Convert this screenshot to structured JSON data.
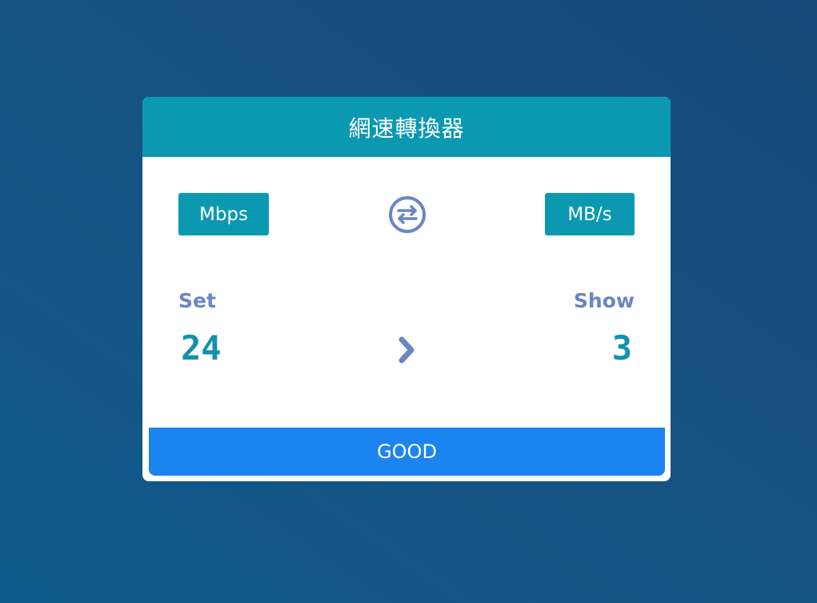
{
  "app": {
    "title": "網速轉換器"
  },
  "units": {
    "from_label": "Mbps",
    "to_label": "MB/s",
    "swap_icon": "swap-arrows-icon"
  },
  "converter": {
    "set_label": "Set",
    "show_label": "Show",
    "set_value": "24",
    "show_value": "3",
    "arrow_icon": "chevron-right-icon"
  },
  "status": {
    "text": "GOOD"
  },
  "colors": {
    "accent": "#0b99b2",
    "label": "#6a86c6",
    "value": "#1092ab",
    "status_bg": "#1b84f0"
  }
}
